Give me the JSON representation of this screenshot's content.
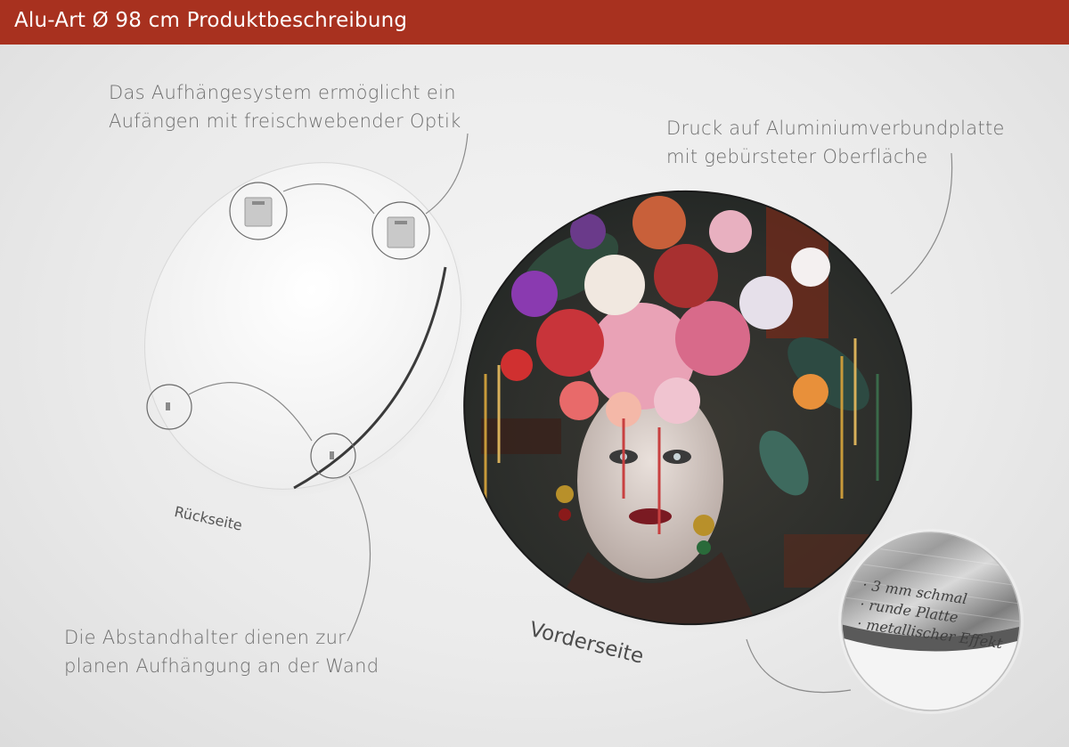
{
  "header": {
    "title": "Alu-Art Ø 98 cm Produktbeschreibung"
  },
  "captions": {
    "hanging_system": [
      "Das Aufhängesystem ermöglicht ein",
      "Aufängen mit freischwebender Optik"
    ],
    "print": [
      "Druck auf Aluminiumverbundplatte",
      "mit gebürsteter Oberfläche"
    ],
    "spacers": [
      "Die Abstandhalter dienen zur",
      "planen Aufhängung an der Wand"
    ]
  },
  "labels": {
    "back": "Rückseite",
    "front": "Vorderseite"
  },
  "detail_features": [
    "· 3 mm schmal",
    "· runde Platte",
    "· metallischer Effekt"
  ],
  "colors": {
    "header": "#a8311f",
    "caption_text": "#6e6e6e"
  }
}
